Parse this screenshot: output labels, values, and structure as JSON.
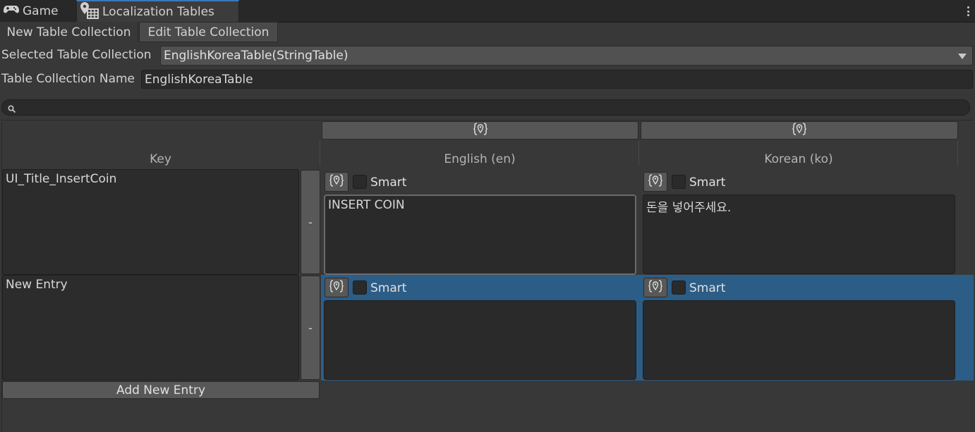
{
  "tabs": [
    {
      "label": "Game",
      "icon": "gamepad-icon"
    },
    {
      "label": "Localization Tables",
      "icon": "localization-tables-icon"
    }
  ],
  "subtabs": {
    "new": "New Table Collection",
    "edit": "Edit Table Collection"
  },
  "selected_collection": {
    "label": "Selected Table Collection",
    "value": "EnglishKoreaTable(StringTable)"
  },
  "collection_name": {
    "label": "Table Collection Name",
    "value": "EnglishKoreaTable"
  },
  "search": {
    "value": ""
  },
  "columns": {
    "key": "Key",
    "english": "English (en)",
    "korean": "Korean (ko)"
  },
  "rows": [
    {
      "key": "UI_Title_InsertCoin",
      "remove_label": "-",
      "english": {
        "smart_label": "Smart",
        "smart": false,
        "value": "INSERT COIN"
      },
      "korean": {
        "smart_label": "Smart",
        "smart": false,
        "value": "돈을 넣어주세요."
      }
    },
    {
      "key": "New Entry",
      "remove_label": "-",
      "english": {
        "smart_label": "Smart",
        "smart": false,
        "value": ""
      },
      "korean": {
        "smart_label": "Smart",
        "smart": false,
        "value": ""
      }
    }
  ],
  "add_entry_label": "Add New Entry",
  "colors": {
    "selected_row": "#2c5d87",
    "active_tab_accent": "#3a79bb"
  }
}
